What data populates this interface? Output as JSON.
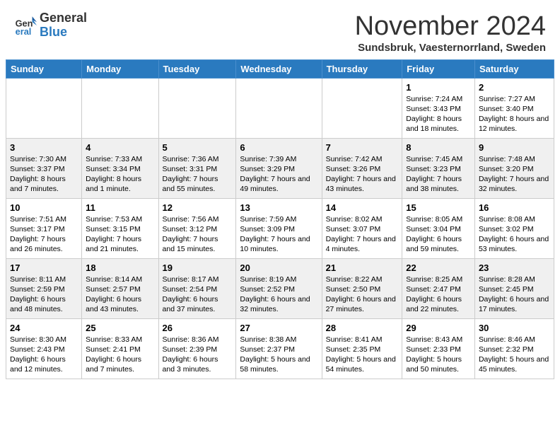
{
  "header": {
    "logo_general": "General",
    "logo_blue": "Blue",
    "month_title": "November 2024",
    "subtitle": "Sundsbruk, Vaesternorrland, Sweden"
  },
  "days_of_week": [
    "Sunday",
    "Monday",
    "Tuesday",
    "Wednesday",
    "Thursday",
    "Friday",
    "Saturday"
  ],
  "weeks": [
    [
      {
        "day": "",
        "info": ""
      },
      {
        "day": "",
        "info": ""
      },
      {
        "day": "",
        "info": ""
      },
      {
        "day": "",
        "info": ""
      },
      {
        "day": "",
        "info": ""
      },
      {
        "day": "1",
        "info": "Sunrise: 7:24 AM\nSunset: 3:43 PM\nDaylight: 8 hours and 18 minutes."
      },
      {
        "day": "2",
        "info": "Sunrise: 7:27 AM\nSunset: 3:40 PM\nDaylight: 8 hours and 12 minutes."
      }
    ],
    [
      {
        "day": "3",
        "info": "Sunrise: 7:30 AM\nSunset: 3:37 PM\nDaylight: 8 hours and 7 minutes."
      },
      {
        "day": "4",
        "info": "Sunrise: 7:33 AM\nSunset: 3:34 PM\nDaylight: 8 hours and 1 minute."
      },
      {
        "day": "5",
        "info": "Sunrise: 7:36 AM\nSunset: 3:31 PM\nDaylight: 7 hours and 55 minutes."
      },
      {
        "day": "6",
        "info": "Sunrise: 7:39 AM\nSunset: 3:29 PM\nDaylight: 7 hours and 49 minutes."
      },
      {
        "day": "7",
        "info": "Sunrise: 7:42 AM\nSunset: 3:26 PM\nDaylight: 7 hours and 43 minutes."
      },
      {
        "day": "8",
        "info": "Sunrise: 7:45 AM\nSunset: 3:23 PM\nDaylight: 7 hours and 38 minutes."
      },
      {
        "day": "9",
        "info": "Sunrise: 7:48 AM\nSunset: 3:20 PM\nDaylight: 7 hours and 32 minutes."
      }
    ],
    [
      {
        "day": "10",
        "info": "Sunrise: 7:51 AM\nSunset: 3:17 PM\nDaylight: 7 hours and 26 minutes."
      },
      {
        "day": "11",
        "info": "Sunrise: 7:53 AM\nSunset: 3:15 PM\nDaylight: 7 hours and 21 minutes."
      },
      {
        "day": "12",
        "info": "Sunrise: 7:56 AM\nSunset: 3:12 PM\nDaylight: 7 hours and 15 minutes."
      },
      {
        "day": "13",
        "info": "Sunrise: 7:59 AM\nSunset: 3:09 PM\nDaylight: 7 hours and 10 minutes."
      },
      {
        "day": "14",
        "info": "Sunrise: 8:02 AM\nSunset: 3:07 PM\nDaylight: 7 hours and 4 minutes."
      },
      {
        "day": "15",
        "info": "Sunrise: 8:05 AM\nSunset: 3:04 PM\nDaylight: 6 hours and 59 minutes."
      },
      {
        "day": "16",
        "info": "Sunrise: 8:08 AM\nSunset: 3:02 PM\nDaylight: 6 hours and 53 minutes."
      }
    ],
    [
      {
        "day": "17",
        "info": "Sunrise: 8:11 AM\nSunset: 2:59 PM\nDaylight: 6 hours and 48 minutes."
      },
      {
        "day": "18",
        "info": "Sunrise: 8:14 AM\nSunset: 2:57 PM\nDaylight: 6 hours and 43 minutes."
      },
      {
        "day": "19",
        "info": "Sunrise: 8:17 AM\nSunset: 2:54 PM\nDaylight: 6 hours and 37 minutes."
      },
      {
        "day": "20",
        "info": "Sunrise: 8:19 AM\nSunset: 2:52 PM\nDaylight: 6 hours and 32 minutes."
      },
      {
        "day": "21",
        "info": "Sunrise: 8:22 AM\nSunset: 2:50 PM\nDaylight: 6 hours and 27 minutes."
      },
      {
        "day": "22",
        "info": "Sunrise: 8:25 AM\nSunset: 2:47 PM\nDaylight: 6 hours and 22 minutes."
      },
      {
        "day": "23",
        "info": "Sunrise: 8:28 AM\nSunset: 2:45 PM\nDaylight: 6 hours and 17 minutes."
      }
    ],
    [
      {
        "day": "24",
        "info": "Sunrise: 8:30 AM\nSunset: 2:43 PM\nDaylight: 6 hours and 12 minutes."
      },
      {
        "day": "25",
        "info": "Sunrise: 8:33 AM\nSunset: 2:41 PM\nDaylight: 6 hours and 7 minutes."
      },
      {
        "day": "26",
        "info": "Sunrise: 8:36 AM\nSunset: 2:39 PM\nDaylight: 6 hours and 3 minutes."
      },
      {
        "day": "27",
        "info": "Sunrise: 8:38 AM\nSunset: 2:37 PM\nDaylight: 5 hours and 58 minutes."
      },
      {
        "day": "28",
        "info": "Sunrise: 8:41 AM\nSunset: 2:35 PM\nDaylight: 5 hours and 54 minutes."
      },
      {
        "day": "29",
        "info": "Sunrise: 8:43 AM\nSunset: 2:33 PM\nDaylight: 5 hours and 50 minutes."
      },
      {
        "day": "30",
        "info": "Sunrise: 8:46 AM\nSunset: 2:32 PM\nDaylight: 5 hours and 45 minutes."
      }
    ]
  ]
}
